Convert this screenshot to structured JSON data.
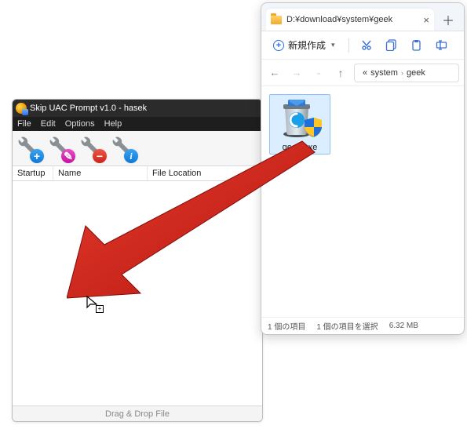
{
  "app": {
    "title": "Skip UAC Prompt v1.0 - hasek",
    "menu": {
      "file": "File",
      "edit": "Edit",
      "options": "Options",
      "help": "Help"
    },
    "toolbar_badges": {
      "add": "+",
      "rename": "✎",
      "remove": "−",
      "info": "i"
    },
    "columns": {
      "startup": "Startup",
      "name": "Name",
      "location": "File Location"
    },
    "status": "Drag & Drop File"
  },
  "explorer": {
    "tab_title": "D:¥download¥system¥geek",
    "new_label": "新規作成",
    "breadcrumb": {
      "prefix": "«",
      "seg1": "system",
      "seg2": "geek"
    },
    "file": {
      "name": "geek.exe"
    },
    "status": {
      "count": "1 個の項目",
      "selected": "1 個の項目を選択",
      "size": "6.32 MB"
    }
  }
}
